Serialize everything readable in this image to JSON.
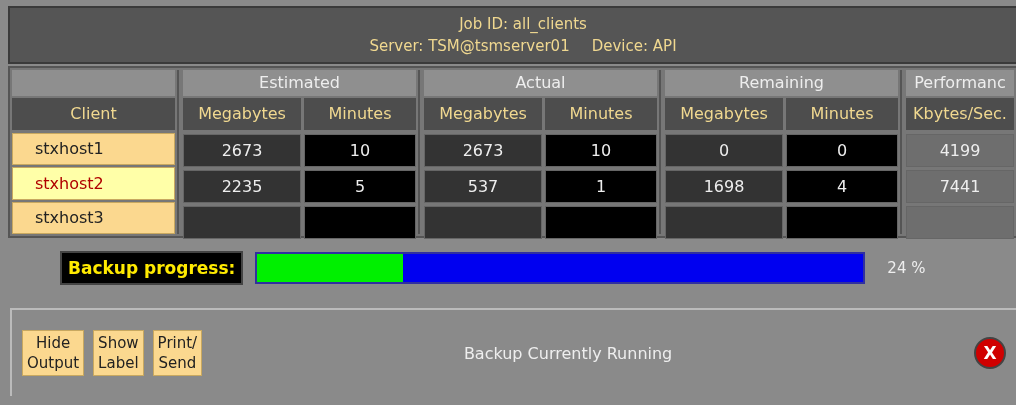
{
  "header": {
    "job": "Job ID: all_clients",
    "server": "Server: TSM@tsmserver01",
    "device": "Device: API"
  },
  "table": {
    "client_heading": "Client",
    "groups": [
      {
        "label": "Estimated",
        "columns": [
          "Megabytes",
          "Minutes"
        ]
      },
      {
        "label": "Actual",
        "columns": [
          "Megabytes",
          "Minutes"
        ]
      },
      {
        "label": "Remaining",
        "columns": [
          "Megabytes",
          "Minutes"
        ]
      },
      {
        "label": "Performanc",
        "columns": [
          "Kbytes/Sec."
        ]
      }
    ],
    "rows": [
      {
        "client": "stxhost1",
        "selected": false,
        "cells": [
          "2673",
          "10",
          "2673",
          "10",
          "0",
          "0",
          "4199"
        ]
      },
      {
        "client": "stxhost2",
        "selected": true,
        "cells": [
          "2235",
          "5",
          "537",
          "1",
          "1698",
          "4",
          "7441"
        ]
      },
      {
        "client": "stxhost3",
        "selected": false
      }
    ]
  },
  "progress": {
    "label": "Backup progress:",
    "level": 0.24,
    "reading": "24 %"
  },
  "footer": {
    "buttons": [
      "Hide\nOutput",
      "Show\nLabel",
      "Print/\nSend"
    ],
    "status": "Backup Currently Running",
    "close": "X"
  }
}
